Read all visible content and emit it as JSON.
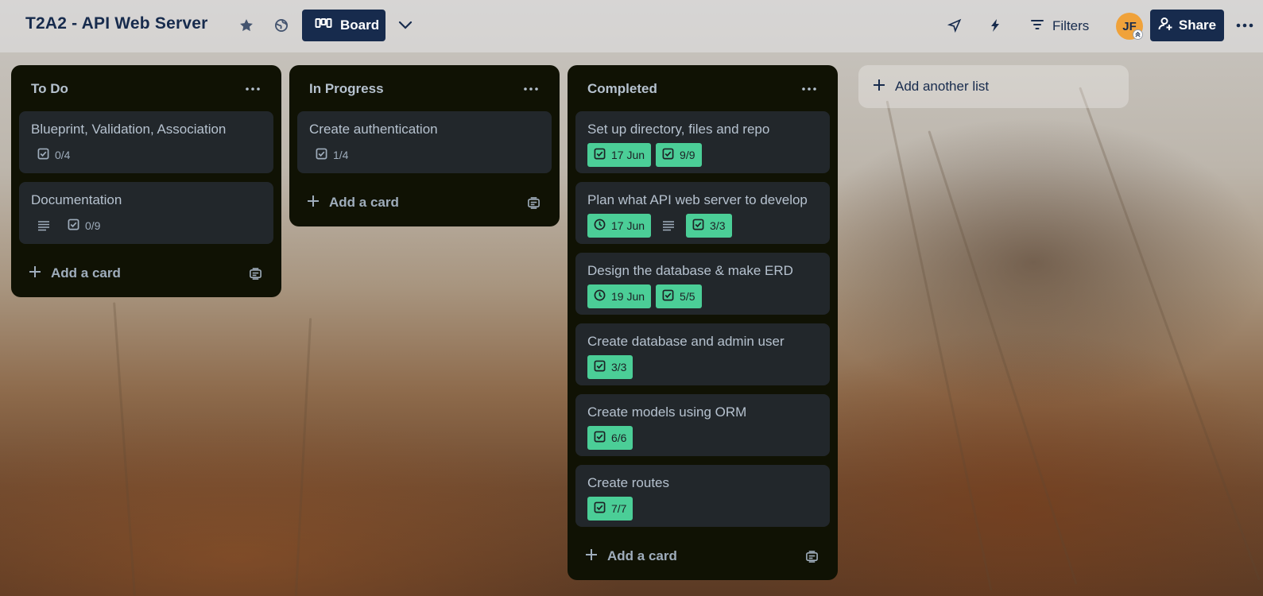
{
  "board": {
    "title": "T2A2 - API Web Server",
    "view_label": "Board",
    "filters_label": "Filters",
    "share_label": "Share",
    "avatar_initials": "JF"
  },
  "lists": [
    {
      "title": "To Do",
      "add_card_label": "Add a card",
      "cards": [
        {
          "title": "Blueprint, Validation, Association",
          "checklist": "0/4"
        },
        {
          "title": "Documentation",
          "has_description": true,
          "checklist": "0/9"
        }
      ]
    },
    {
      "title": "In Progress",
      "add_card_label": "Add a card",
      "cards": [
        {
          "title": "Create authentication",
          "checklist": "1/4"
        }
      ]
    },
    {
      "title": "Completed",
      "add_card_label": "Add a card",
      "cards": [
        {
          "title": "Set up directory, files and repo",
          "due": "17 Jun",
          "due_icon": "checkbox-icon",
          "checklist": "9/9"
        },
        {
          "title": "Plan what API web server to develop",
          "due": "17 Jun",
          "due_icon": "clock-icon",
          "has_description": true,
          "checklist": "3/3"
        },
        {
          "title": "Design the database & make ERD",
          "due": "19 Jun",
          "due_icon": "clock-icon",
          "checklist": "5/5"
        },
        {
          "title": "Create database and admin user",
          "checklist": "3/3"
        },
        {
          "title": "Create models using ORM",
          "checklist": "6/6"
        },
        {
          "title": "Create routes",
          "checklist": "7/7"
        }
      ]
    }
  ],
  "add_list_label": "Add another list",
  "colors": {
    "header_bg": "#e1e1e4",
    "primary_button": "#172b4d",
    "list_bg": "#101204",
    "card_bg": "#22272b",
    "done_badge": "#4bce97",
    "avatar": "#f0a23a"
  }
}
